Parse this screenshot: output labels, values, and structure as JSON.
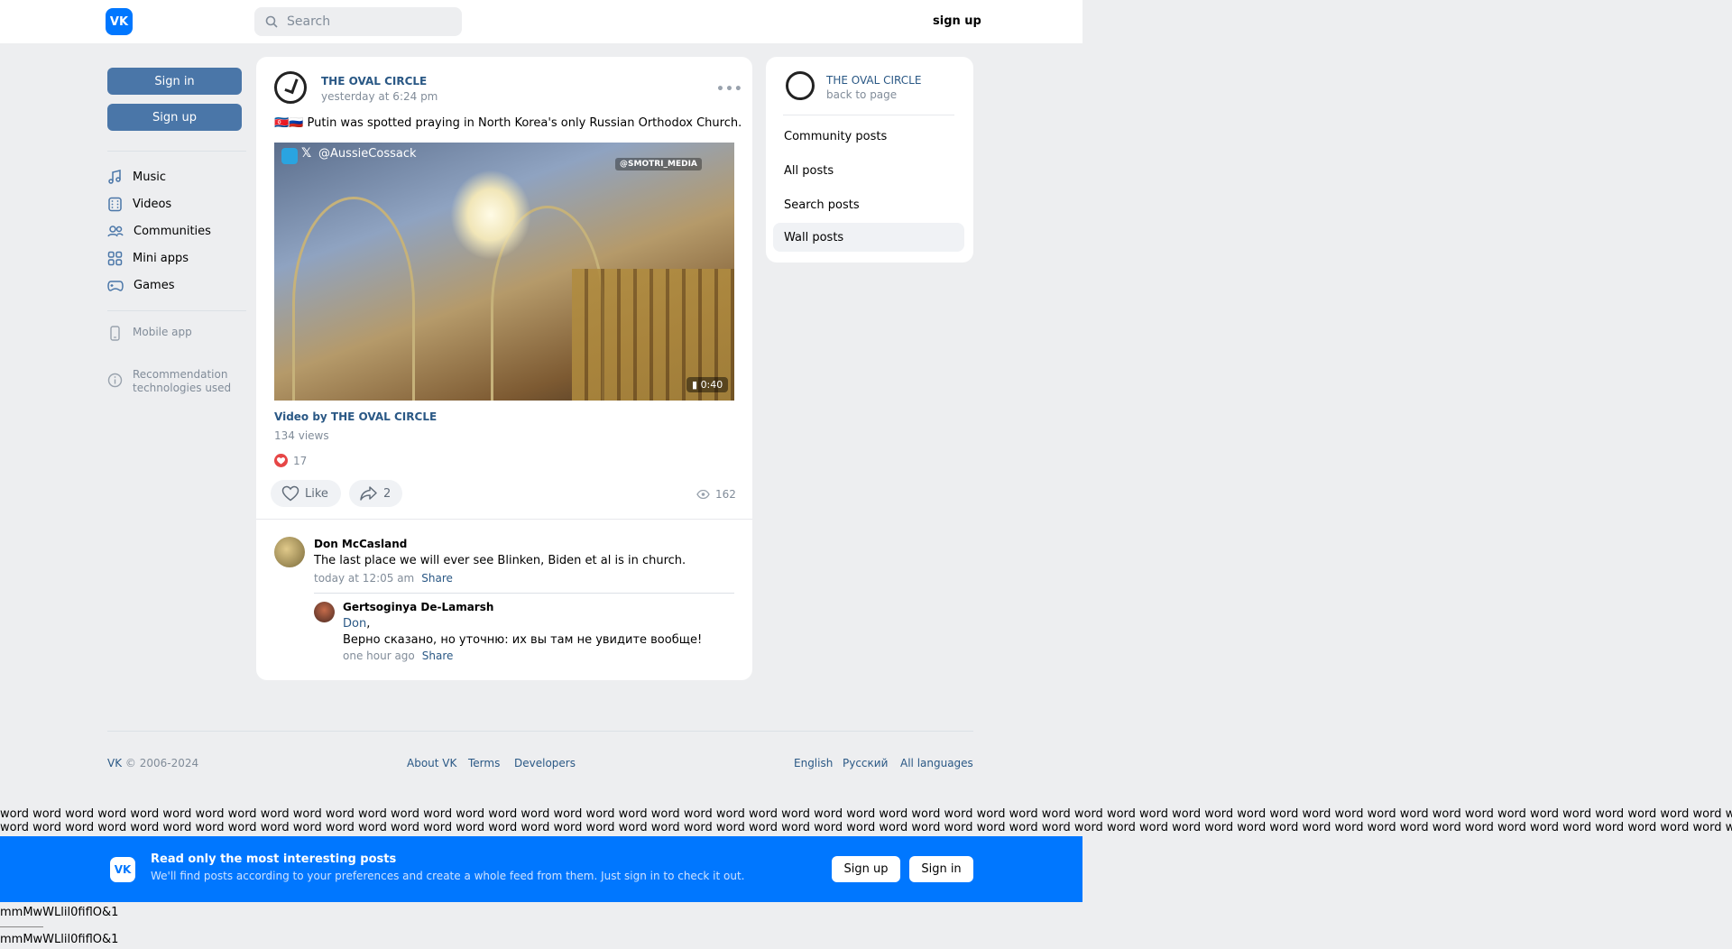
{
  "header": {
    "logo_text": "VK",
    "search_placeholder": "Search",
    "signup_label": "sign up"
  },
  "sidebar": {
    "signin_label": "Sign in",
    "signup_label": "Sign up",
    "nav": [
      {
        "label": "Music",
        "icon": "music-icon"
      },
      {
        "label": "Videos",
        "icon": "video-icon"
      },
      {
        "label": "Communities",
        "icon": "communities-icon"
      },
      {
        "label": "Mini apps",
        "icon": "mini-apps-icon"
      },
      {
        "label": "Games",
        "icon": "games-icon"
      }
    ],
    "mobile_app": "Mobile app",
    "recommendation_line1": "Recommendation",
    "recommendation_line2": "technologies used"
  },
  "post": {
    "group_name": "THE OVAL CIRCLE",
    "time": "yesterday at 6:24 pm",
    "text": "🇰🇵🇷🇺 Putin was spotted praying in North Korea's only Russian Orthodox Church.",
    "video": {
      "handle": "@AussieCossack",
      "watermark": "@SMOTRI_MEDIA",
      "duration": "0:40",
      "title": "Video by THE OVAL CIRCLE",
      "views": "134 views"
    },
    "reactions_count": "17",
    "like_label": "Like",
    "share_count": "2",
    "views_count": "162",
    "comments": [
      {
        "author": "Don McCasland",
        "text": "The last place we will ever see Blinken, Biden et al is in church.",
        "time": "today at 12:05 am",
        "share_label": "Share"
      }
    ],
    "reply": {
      "author": "Gertsoginya De-Lamarsh",
      "mention": "Don",
      "text": "Верно сказано, но уточню: их вы там не увидите вообще!",
      "time": "one hour ago",
      "share_label": "Share"
    }
  },
  "right_panel": {
    "group_name": "THE OVAL CIRCLE",
    "back_label": "back to page",
    "items": [
      "Community posts",
      "All posts",
      "Search posts",
      "Wall posts"
    ],
    "active_item": "Wall posts"
  },
  "footer": {
    "copyright": "VK © 2006-2024",
    "links": [
      "About VK",
      "Terms",
      "Developers"
    ],
    "languages": [
      "English",
      "Русский",
      "All languages"
    ]
  },
  "filler_line": "word word word word word word word word word word word word word word word word word word word word word word word word word word word word word word word word word word word word word word word word word word word word word word word word word word word word word word word word word word word word word word word word word word word word word word word word word word word word word word word word word",
  "banner": {
    "logo_text": "VK",
    "title": "Read only the most interesting posts",
    "subtitle": "We'll find posts according to your preferences and create a whole feed from them. Just sign in to check it out.",
    "signup_label": "Sign up",
    "signin_label": "Sign in"
  },
  "tail_text": "mmMwWLlil0fiflO&1",
  "colors": {
    "accent": "#0077ff",
    "link": "#2a5885",
    "button": "#4a76a8",
    "background": "#edeef0"
  }
}
